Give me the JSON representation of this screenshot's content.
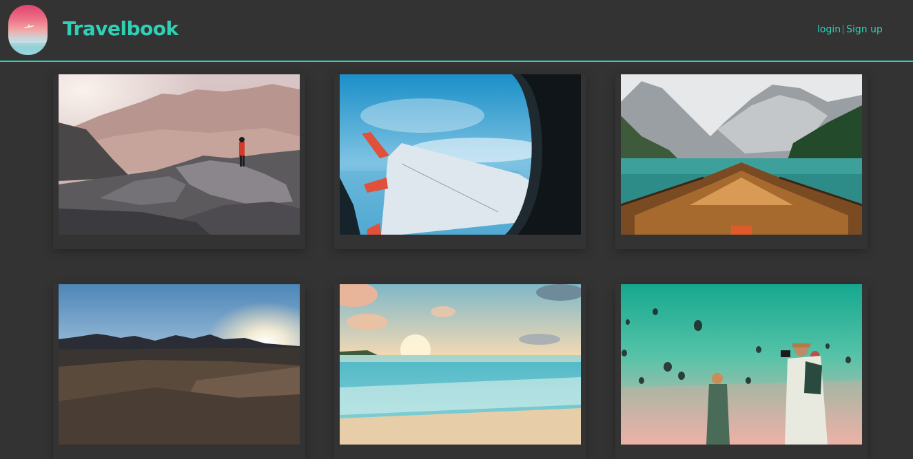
{
  "header": {
    "brand": "Travelbook",
    "nav": {
      "login": "login",
      "signup": "Sign up"
    }
  },
  "gallery": {
    "photos": [
      {
        "icon": "desert-hiker-photo"
      },
      {
        "icon": "airplane-window-photo"
      },
      {
        "icon": "mountain-lake-boat-photo"
      },
      {
        "icon": "desert-sunset-photo"
      },
      {
        "icon": "beach-sunset-photo"
      },
      {
        "icon": "hot-air-balloons-photo"
      }
    ]
  },
  "colors": {
    "accent": "#2fd0b5",
    "background": "#333333"
  }
}
